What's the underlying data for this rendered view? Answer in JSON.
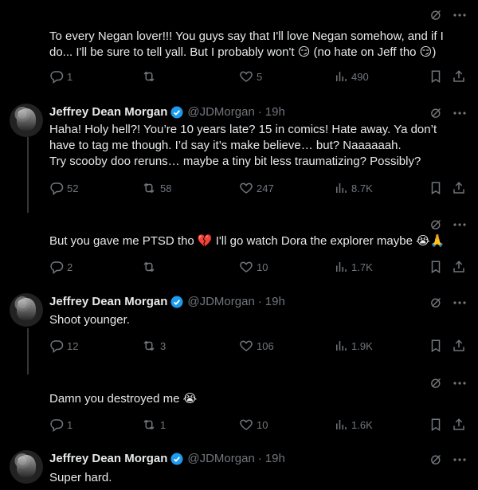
{
  "posts": [
    {
      "id": "p0",
      "has_header": false,
      "text": "To every Negan lover!!! You guys say that I'll love Negan somehow, and if I do... I'll be sure to tell yall. But I probably won't 😏 (no hate on Jeff tho 😏)",
      "replies": "1",
      "reposts": "",
      "likes": "5",
      "views": "490"
    },
    {
      "id": "p1",
      "has_header": true,
      "name": "Jeffrey Dean Morgan",
      "handle": "@JDMorgan",
      "time": "19h",
      "text": "Haha! Holy hell?! You’re 10 years late? 15 in comics! Hate away. Ya don’t have to tag me though. I’d say it’s make believe… but? Naaaaaah.\nTry scooby doo reruns… maybe a tiny bit less traumatizing? Possibly?",
      "replies": "52",
      "reposts": "58",
      "likes": "247",
      "views": "8.7K"
    },
    {
      "id": "p2",
      "has_header": false,
      "text": "But you gave me PTSD tho 💔 I'll go watch Dora the explorer maybe 😭🙏",
      "replies": "2",
      "reposts": "",
      "likes": "10",
      "views": "1.7K"
    },
    {
      "id": "p3",
      "has_header": true,
      "name": "Jeffrey Dean Morgan",
      "handle": "@JDMorgan",
      "time": "19h",
      "text": "Shoot younger.",
      "replies": "12",
      "reposts": "3",
      "likes": "106",
      "views": "1.9K"
    },
    {
      "id": "p4",
      "has_header": false,
      "text": "Damn you destroyed me 😭",
      "replies": "1",
      "reposts": "1",
      "likes": "10",
      "views": "1.6K"
    },
    {
      "id": "p5",
      "has_header": true,
      "name": "Jeffrey Dean Morgan",
      "handle": "@JDMorgan",
      "time": "19h",
      "text": "Super hard."
    }
  ],
  "colors": {
    "background": "#000000",
    "text": "#e7e9ea",
    "muted": "#71767b",
    "verified": "#1d9bf0",
    "thread_line": "#333639"
  },
  "icons": [
    "grok-icon",
    "more-icon",
    "reply-icon",
    "repost-icon",
    "like-icon",
    "views-icon",
    "bookmark-icon",
    "share-icon",
    "verified-badge-icon"
  ]
}
